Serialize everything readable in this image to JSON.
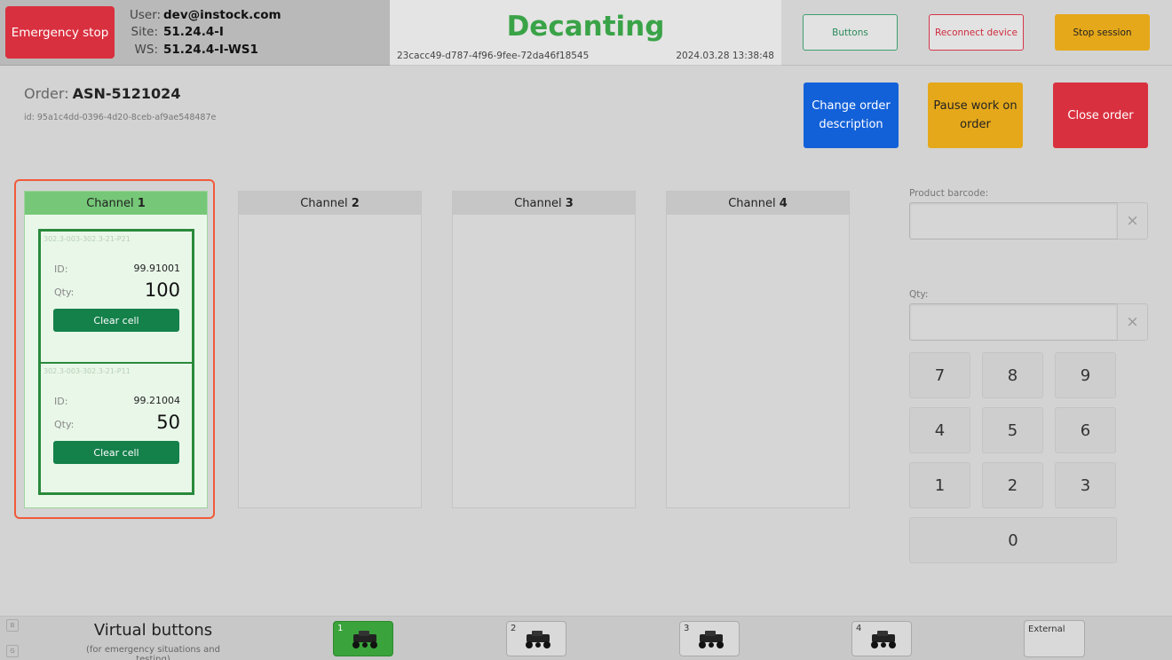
{
  "header": {
    "emergency_stop": "Emergency stop",
    "user_label": "User:",
    "user_value": "dev@instock.com",
    "site_label": "Site:",
    "site_value": "51.24.4-I",
    "ws_label": "WS:",
    "ws_value": "51.24.4-I-WS1",
    "title": "Decanting",
    "session_id": "23cacc49-d787-4f96-9fee-72da46f18545",
    "datetime": "2024.03.28 13:38:48",
    "buttons_label": "Buttons",
    "reconnect_label": "Reconnect device",
    "stop_session_label": "Stop session"
  },
  "order": {
    "label": "Order:",
    "name": "ASN-5121024",
    "id": "id: 95a1c4dd-0396-4d20-8ceb-af9ae548487e",
    "change_label": "Change order description",
    "pause_label": "Pause work on order",
    "close_label": "Close order"
  },
  "channels": [
    {
      "label": "Channel",
      "number": "1"
    },
    {
      "label": "Channel",
      "number": "2"
    },
    {
      "label": "Channel",
      "number": "3"
    },
    {
      "label": "Channel",
      "number": "4"
    }
  ],
  "cells": [
    {
      "address": "302.3-003-302.3-21-P21",
      "id_label": "ID:",
      "id_value": "99.91001",
      "qty_label": "Qty:",
      "qty_value": "100",
      "clear_label": "Clear cell"
    },
    {
      "address": "302.3-003-302.3-21-P11",
      "id_label": "ID:",
      "id_value": "99.21004",
      "qty_label": "Qty:",
      "qty_value": "50",
      "clear_label": "Clear cell"
    }
  ],
  "form": {
    "barcode_label": "Product barcode:",
    "barcode_value": "",
    "qty_label": "Qty:",
    "qty_value": "",
    "clear_glyph": "×"
  },
  "keypad": [
    "7",
    "8",
    "9",
    "4",
    "5",
    "6",
    "1",
    "2",
    "3",
    "0"
  ],
  "bottom": {
    "mini_a": "B",
    "mini_b": "G",
    "title": "Virtual buttons",
    "subtitle": "(for emergency situations and testing)",
    "robots": [
      "1",
      "2",
      "3",
      "4"
    ],
    "external": "External"
  },
  "colors": {
    "emergency": "#d9303f",
    "title_green": "#3aa348",
    "primary_blue": "#1361d9",
    "warning_yellow": "#e5a81a",
    "cell_green": "#14804a",
    "highlight_frame": "#f05a3b"
  }
}
